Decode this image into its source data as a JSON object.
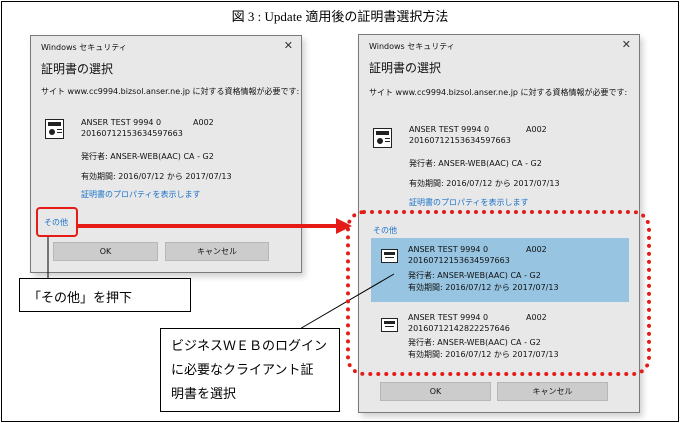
{
  "figure_title": "図 3 : Update 適用後の証明書選択方法",
  "left_dialog": {
    "window_title": "Windows セキュリティ",
    "close": "✕",
    "heading": "証明書の選択",
    "site_text": "サイト www.cc9994.bizsol.anser.ne.jp に対する資格情報が必要です:",
    "cert": {
      "name": "ANSER TEST 9994 0",
      "code": "A002",
      "serial": "20160712153634597663",
      "issuer": "発行者: ANSER-WEB(AAC) CA - G2",
      "validity": "有効期間: 2016/07/12 から 2017/07/13",
      "properties_link": "証明書のプロパティを表示します"
    },
    "more_choices": "その他",
    "ok": "OK",
    "cancel": "キャンセル"
  },
  "right_dialog": {
    "window_title": "Windows セキュリティ",
    "close": "✕",
    "heading": "証明書の選択",
    "site_text": "サイト www.cc9994.bizsol.anser.ne.jp に対する資格情報が必要です:",
    "cert": {
      "name": "ANSER TEST 9994 0",
      "code": "A002",
      "serial": "20160712153634597663",
      "issuer": "発行者: ANSER-WEB(AAC) CA - G2",
      "validity": "有効期間: 2016/07/12 から 2017/07/13",
      "properties_link": "証明書のプロパティを表示します"
    },
    "more_choices": "その他",
    "list": [
      {
        "name": "ANSER TEST 9994 0",
        "code": "A002",
        "serial": "20160712153634597663",
        "issuer": "発行者: ANSER-WEB(AAC) CA - G2",
        "validity": "有効期間: 2016/07/12 から 2017/07/13"
      },
      {
        "name": "ANSER TEST 9994 0",
        "code": "A002",
        "serial": "20160712142822257646",
        "issuer": "発行者: ANSER-WEB(AAC) CA - G2",
        "validity": "有効期間: 2016/07/12 から 2017/07/13"
      }
    ],
    "ok": "OK",
    "cancel": "キャンセル"
  },
  "callouts": {
    "press_more": "「その他」を押下",
    "choose_line1": "ビジネスＷＥＢのログイン",
    "choose_line2": "に必要なクライアント証",
    "choose_line3": "明書を選択"
  },
  "colors": {
    "annotation_red": "#e41b17",
    "selected_item": "#97c4e1",
    "link_blue": "#1a73c9",
    "dialog_bg": "#e8e8e8"
  }
}
